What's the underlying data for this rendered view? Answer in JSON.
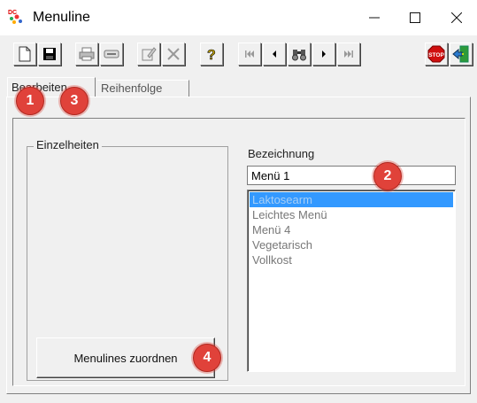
{
  "window": {
    "title": "Menuline",
    "minimize": "–",
    "maximize": "☐",
    "close": "✕"
  },
  "toolbar": {
    "buttons": [
      {
        "icon": "new-document-icon"
      },
      {
        "icon": "save-icon"
      },
      {
        "icon": "print-icon"
      },
      {
        "icon": "minus-icon"
      },
      {
        "icon": "edit-icon"
      },
      {
        "icon": "delete-icon"
      },
      {
        "icon": "help-icon"
      },
      {
        "icon": "first-record-icon"
      },
      {
        "icon": "previous-record-icon"
      },
      {
        "icon": "search-binoculars-icon"
      },
      {
        "icon": "next-record-icon"
      },
      {
        "icon": "last-record-icon"
      },
      {
        "icon": "stop-icon"
      },
      {
        "icon": "exit-icon"
      }
    ],
    "stop_label": "STOP"
  },
  "tabs": [
    {
      "label": "Bearbeiten",
      "active": true
    },
    {
      "label": "Reihenfolge",
      "active": false
    }
  ],
  "group": {
    "label": "Einzelheiten"
  },
  "field": {
    "label": "Bezeichnung",
    "value": "Menü 1"
  },
  "list": {
    "items": [
      {
        "label": "Laktosearm",
        "selected": true
      },
      {
        "label": "Leichtes Menü",
        "selected": false
      },
      {
        "label": "Menü 4",
        "selected": false
      },
      {
        "label": "Vegetarisch",
        "selected": false
      },
      {
        "label": "Vollkost",
        "selected": false
      }
    ]
  },
  "button": {
    "label": "Menulines zuordnen"
  },
  "annotations": [
    "1",
    "2",
    "3",
    "4"
  ],
  "colors": {
    "selection": "#3399ff",
    "badge": "#e0423a"
  }
}
